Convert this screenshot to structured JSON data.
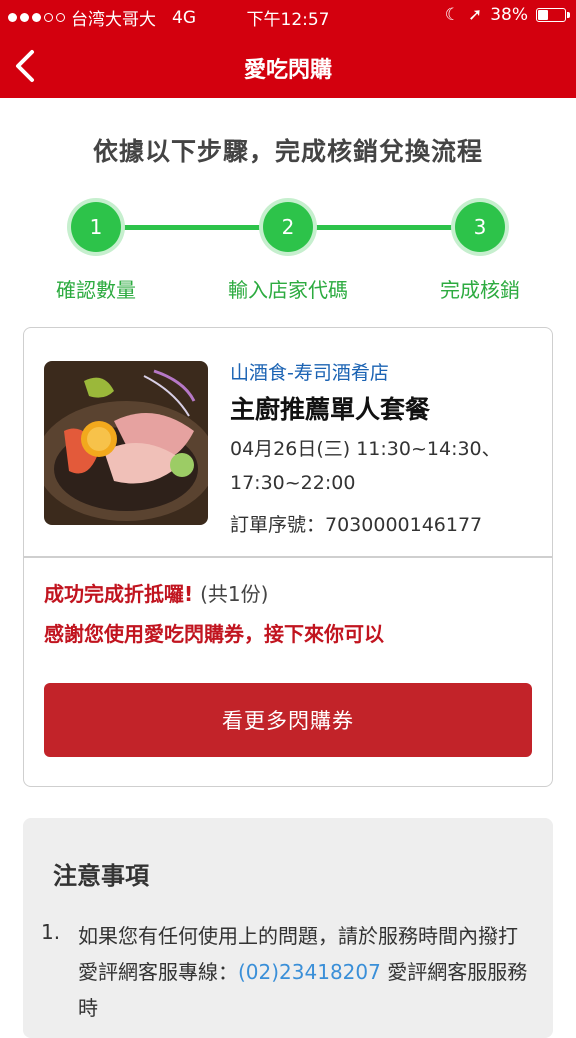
{
  "status_bar": {
    "carrier": "台湾大哥大",
    "network": "4G",
    "time": "下午12:57",
    "battery": "38%",
    "battery_level": 0.38
  },
  "nav": {
    "title": "愛吃閃購",
    "back_icon": "chevron-left-icon"
  },
  "heading": "依據以下步驟，完成核銷兌換流程",
  "steps": [
    {
      "number": "1",
      "label": "確認數量"
    },
    {
      "number": "2",
      "label": "輸入店家代碼"
    },
    {
      "number": "3",
      "label": "完成核銷"
    }
  ],
  "order_card": {
    "shop_name": "山酒食-寿司酒肴店",
    "dish_name": "主廚推薦單人套餐",
    "date_line1": "04月26日(三) 11:30~14:30、",
    "date_line2": "17:30~22:00",
    "order_no": "訂單序號：7030000146177",
    "success_text": "成功完成折抵囉!",
    "success_count": "(共1份)",
    "thanks_text": "感謝您使用愛吃閃購券，接下來你可以",
    "more_button": "看更多閃購券"
  },
  "notice": {
    "title": "注意事項",
    "item_number": "1.",
    "item_text_before": "如果您有任何使用上的問題，請於服務時間內撥打愛評網客服專線：",
    "phone": "(02)23418207",
    "item_text_after": " 愛評網客服服務時"
  },
  "colors": {
    "brand_red": "#d3000e",
    "step_green": "#2dc34a",
    "link_blue": "#1b63b3"
  }
}
